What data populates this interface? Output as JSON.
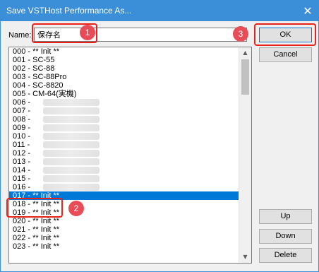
{
  "window": {
    "title": "Save VSTHost Performance As..."
  },
  "form": {
    "name_label": "Name:",
    "name_value": "保存名"
  },
  "buttons": {
    "ok": "OK",
    "cancel": "Cancel",
    "up": "Up",
    "down": "Down",
    "delete": "Delete"
  },
  "list": {
    "items": [
      {
        "label": "000 - ** Init **"
      },
      {
        "label": "001 - SC-55"
      },
      {
        "label": "002 - SC-88"
      },
      {
        "label": "003 - SC-88Pro"
      },
      {
        "label": "004 - SC-8820"
      },
      {
        "label": "005 - CM-64(実機)"
      },
      {
        "label": "006 -"
      },
      {
        "label": "007 -"
      },
      {
        "label": "008 -"
      },
      {
        "label": "009 -"
      },
      {
        "label": "010 -"
      },
      {
        "label": "011 -"
      },
      {
        "label": "012 -"
      },
      {
        "label": "013 -"
      },
      {
        "label": "014 -"
      },
      {
        "label": "015 -"
      },
      {
        "label": "016 -"
      },
      {
        "label": "017 - ** Init **"
      },
      {
        "label": "018 - ** Init **"
      },
      {
        "label": "019 - ** Init **"
      },
      {
        "label": "020 - ** Init **"
      },
      {
        "label": "021 - ** Init **"
      },
      {
        "label": "022 - ** Init **"
      },
      {
        "label": "023 - ** Init **"
      }
    ],
    "selected_index": 17
  },
  "annotations": {
    "marker_1": "1",
    "marker_2": "2",
    "marker_3": "3",
    "marker_color": "#e8211b",
    "badge_color": "#e84c57"
  }
}
